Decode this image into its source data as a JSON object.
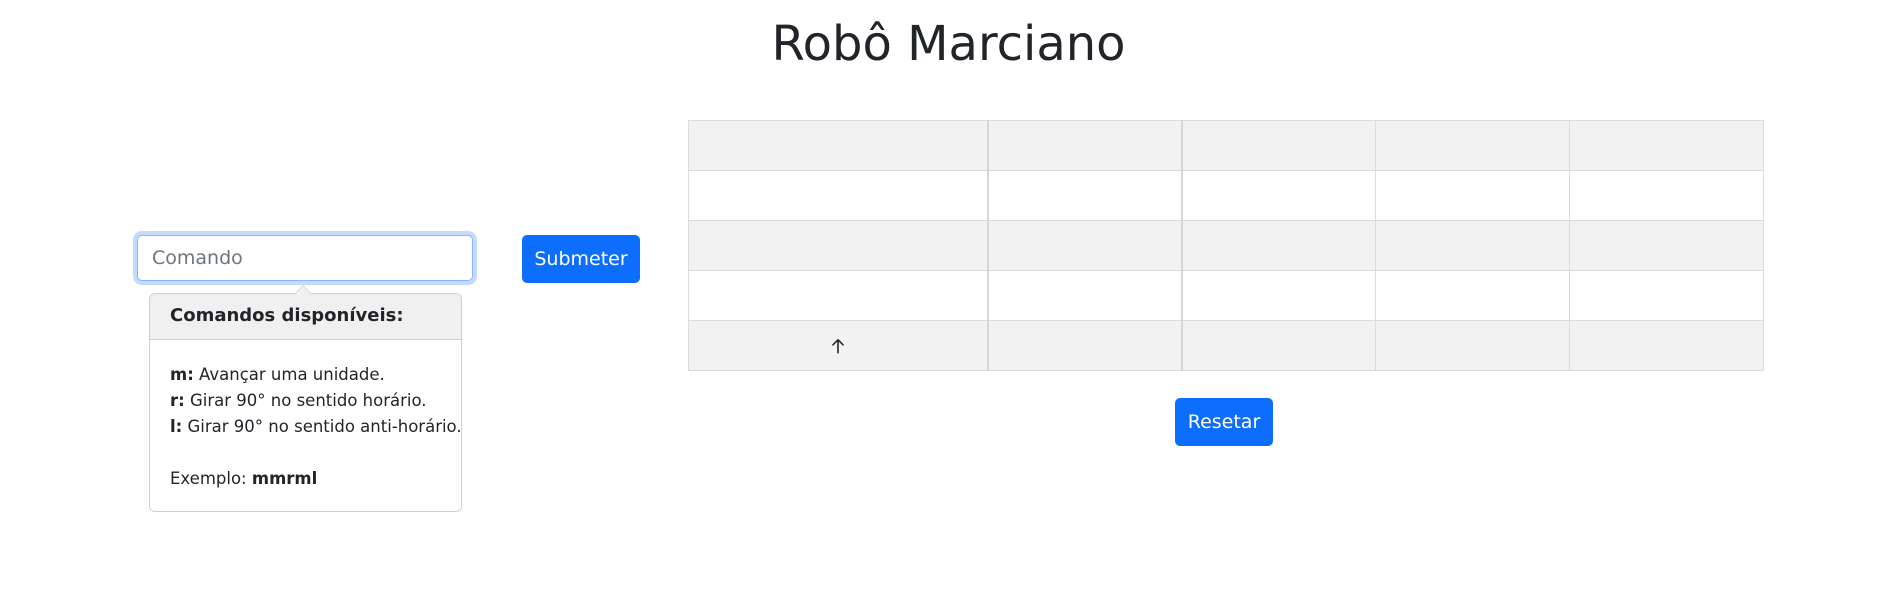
{
  "page": {
    "title": "Robô Marciano"
  },
  "command": {
    "placeholder": "Comando",
    "value": "",
    "submit_label": "Submeter"
  },
  "popover": {
    "header": "Comandos disponíveis:",
    "commands": [
      {
        "key": "m:",
        "description": "Avançar uma unidade."
      },
      {
        "key": "r:",
        "description": "Girar 90° no sentido horário."
      },
      {
        "key": "l:",
        "description": "Girar 90° no sentido anti-horário."
      }
    ],
    "example_label": "Exemplo:",
    "example_value": "mmrml"
  },
  "grid": {
    "rows": 5,
    "cols": 5,
    "robot": {
      "row": 5,
      "col": 1,
      "direction": "up",
      "icon": "arrow-up-icon"
    }
  },
  "reset_label": "Resetar",
  "colors": {
    "primary": "#0d6efd",
    "stripe": "#f2f2f2"
  }
}
